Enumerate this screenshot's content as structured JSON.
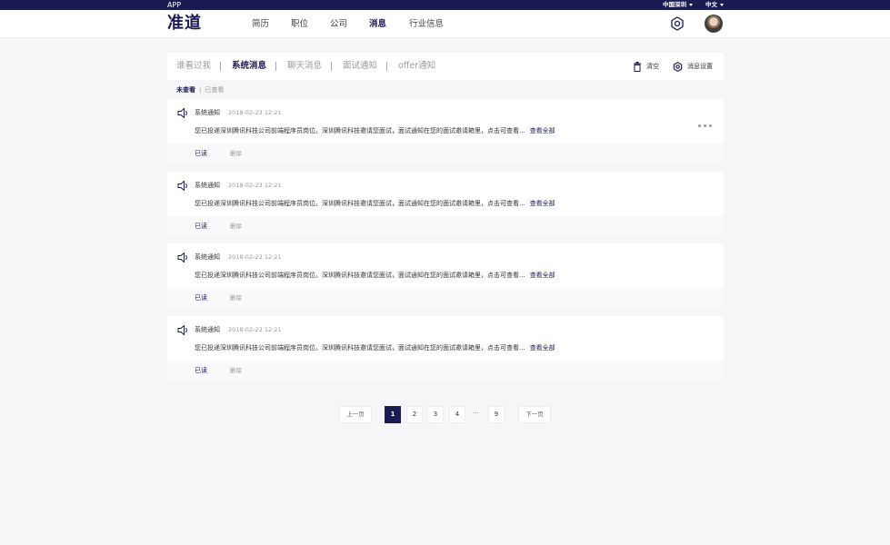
{
  "topbar": {
    "app": "APP",
    "city": "中国深圳",
    "language": "中文"
  },
  "header": {
    "logo": "准道",
    "nav": [
      "简历",
      "职位",
      "公司",
      "消息",
      "行业信息"
    ],
    "active_nav": "消息"
  },
  "tabs": {
    "items": [
      "谁看过我",
      "系统消息",
      "聊天消息",
      "面试通知",
      "offer通知"
    ],
    "active": "系统消息",
    "clear_label": "清空",
    "settings_label": "消息设置"
  },
  "filters": {
    "unread": "未查看",
    "read": "已查看"
  },
  "messages": [
    {
      "type": "系统通知",
      "time": "2018-02-23 12:21",
      "body": "您已投递深圳腾讯科技公司前端程序员岗位。深圳腾讯科技邀请您面试，面试通知在您的面试邀请箱里，点击可查看...",
      "more": "查看全部",
      "read": "已读",
      "delete": "删除"
    },
    {
      "type": "系统通知",
      "time": "2018-02-23 12:21",
      "body": "您已投递深圳腾讯科技公司前端程序员岗位。深圳腾讯科技邀请您面试，面试通知在您的面试邀请箱里，点击可查看...",
      "more": "查看全部",
      "read": "已读",
      "delete": "删除"
    },
    {
      "type": "系统通知",
      "time": "2018-02-23 12:21",
      "body": "您已投递深圳腾讯科技公司前端程序员岗位。深圳腾讯科技邀请您面试，面试通知在您的面试邀请箱里，点击可查看...",
      "more": "查看全部",
      "read": "已读",
      "delete": "删除"
    },
    {
      "type": "系统通知",
      "time": "2018-02-23 12:21",
      "body": "您已投递深圳腾讯科技公司前端程序员岗位。深圳腾讯科技邀请您面试，面试通知在您的面试邀请箱里，点击可查看...",
      "more": "查看全部",
      "read": "已读",
      "delete": "删除"
    }
  ],
  "pagination": {
    "prev": "上一页",
    "next": "下一页",
    "pages": [
      "1",
      "2",
      "3",
      "4",
      "9"
    ],
    "ellipsis": "···",
    "current": "1"
  },
  "colors": {
    "brand": "#1b1b54",
    "background": "#f6f6f8"
  },
  "icons": {
    "settings": "gear-icon",
    "clear": "trash-icon",
    "notice": "speaker-icon",
    "more": "more-dots-icon"
  }
}
